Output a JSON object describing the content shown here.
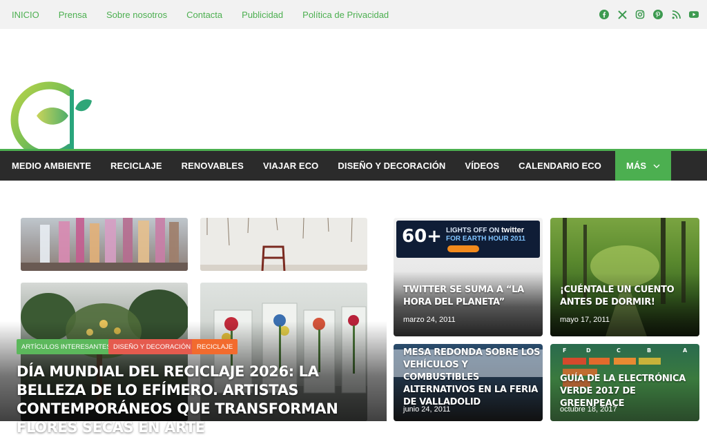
{
  "topnav": {
    "items": [
      "INICIO",
      "Prensa",
      "Sobre nosotros",
      "Contacta",
      "Publicidad",
      "Política de Privacidad"
    ]
  },
  "social": {
    "icons": [
      "facebook-icon",
      "x-icon",
      "instagram-icon",
      "pinterest-icon",
      "rss-icon",
      "youtube-icon"
    ],
    "color": "#3d9a50"
  },
  "mainnav": {
    "items": [
      "MEDIO AMBIENTE",
      "RECICLAJE",
      "RENOVABLES",
      "VIAJAR ECO",
      "DISEÑO Y DECORACIÓN",
      "VÍDEOS",
      "CALENDARIO ECO"
    ],
    "more_label": "MÁS",
    "accent": "#4caf50"
  },
  "featured": {
    "badges": [
      {
        "label": "ARTÍCULOS INTERESANTES",
        "color": "#5cb85c"
      },
      {
        "label": "DISEÑO Y DECORACIÓN",
        "color": "#e55b4e"
      },
      {
        "label": "RECICLAJE",
        "color": "#f26b2e"
      }
    ],
    "title": "DÍA MUNDIAL DEL RECICLAJE 2026: LA BELLEZA DE LO EFÍMERO. ARTISTAS CONTEMPORÁNEOS QUE TRANSFORMAN FLORES SECAS EN ARTE"
  },
  "cards": [
    {
      "title": "TWITTER SE SUMA A “LA HORA DEL PLANETA”",
      "date": "marzo 24, 2011",
      "banner": {
        "line1": "LIGHTS OFF ON",
        "brand": "twitter",
        "line2": "FOR EARTH HOUR 2011",
        "num": "60+"
      }
    },
    {
      "title": "¡CUÉNTALE UN CUENTO ANTES DE DORMIR!",
      "date": "mayo 17, 2011"
    },
    {
      "title": "MESA REDONDA SOBRE LOS VEHÍCULOS Y COMBUSTIBLES ALTERNATIVOS EN LA FERIA DE VALLADOLID",
      "date": "junio 24, 2011"
    },
    {
      "title": "GUÍA DE LA ELECTRÓNICA VERDE 2017 DE GREENPEACE",
      "date": "octubre 18, 2017"
    }
  ]
}
